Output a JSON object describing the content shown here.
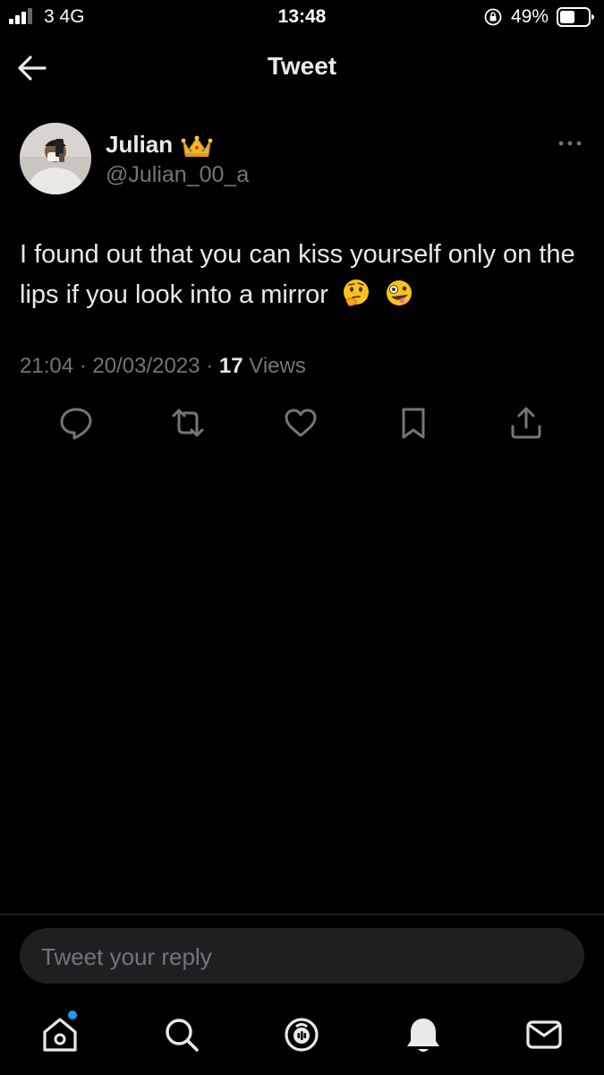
{
  "status_bar": {
    "carrier": "3  4G",
    "time": "13:48",
    "battery": "49%",
    "icons": [
      "signal-icon",
      "orientation-lock-icon",
      "battery-icon"
    ]
  },
  "header": {
    "title": "Tweet",
    "back_icon": "back-arrow-icon"
  },
  "tweet": {
    "author": {
      "display_name": "Julian",
      "name_emoji": "crown-icon",
      "handle": "@Julian_00_a"
    },
    "text": "I found out that you can kiss yourself only on the lips if you look into a mirror",
    "text_emojis": [
      "thinking-face-emoji",
      "zany-face-emoji"
    ],
    "time": "21:04",
    "date": "20/03/2023",
    "views_count": "17",
    "views_label": "Views",
    "actions": [
      "reply-icon",
      "retweet-icon",
      "like-icon",
      "bookmark-icon",
      "share-icon"
    ]
  },
  "reply": {
    "placeholder": "Tweet your reply"
  },
  "bottom_nav": {
    "items": [
      "home-icon",
      "search-icon",
      "spaces-icon",
      "notifications-icon",
      "messages-icon"
    ],
    "accent": "#1d9bf0"
  },
  "colors": {
    "background": "#000000",
    "text": "#e7e9ea",
    "muted": "#71767b"
  }
}
